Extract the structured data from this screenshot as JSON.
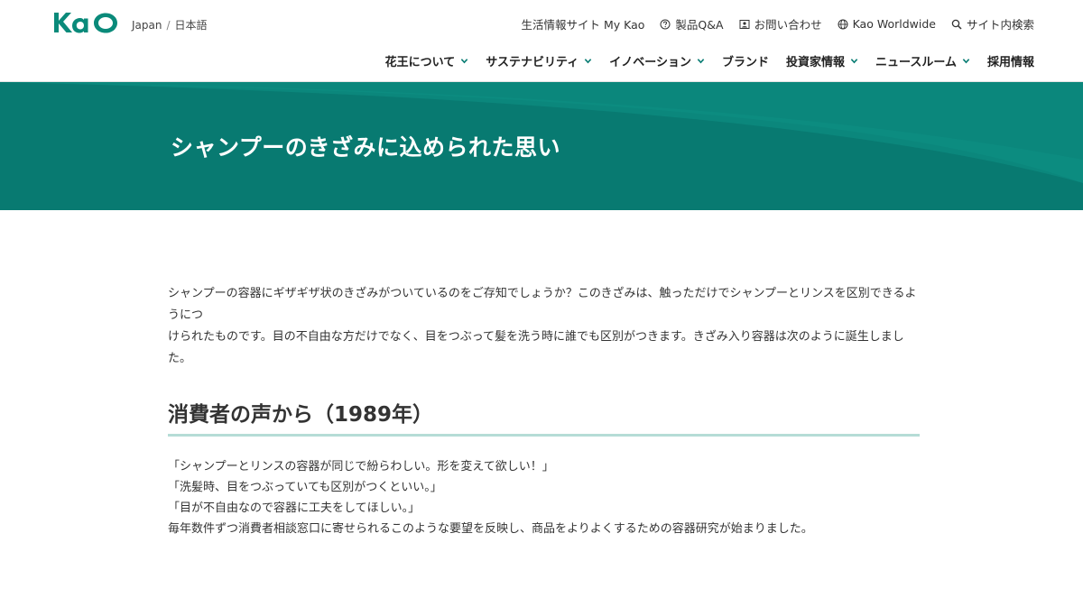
{
  "header": {
    "logo_text": "Kao",
    "region": "Japan",
    "separator": "/",
    "language": "日本語",
    "utility_nav": [
      {
        "label": "生活情報サイト My Kao",
        "icon": "none"
      },
      {
        "label": "製品Q&A",
        "icon": "question-circle-icon"
      },
      {
        "label": "お問い合わせ",
        "icon": "contact-icon"
      },
      {
        "label": "Kao Worldwide",
        "icon": "globe-icon"
      },
      {
        "label": "サイト内検索",
        "icon": "search-icon"
      }
    ],
    "main_nav": [
      {
        "label": "花王について",
        "has_dropdown": true
      },
      {
        "label": "サステナビリティ",
        "has_dropdown": true
      },
      {
        "label": "イノベーション",
        "has_dropdown": true
      },
      {
        "label": "ブランド",
        "has_dropdown": false
      },
      {
        "label": "投資家情報",
        "has_dropdown": true
      },
      {
        "label": "ニュースルーム",
        "has_dropdown": true
      },
      {
        "label": "採用情報",
        "has_dropdown": false
      }
    ]
  },
  "hero": {
    "title": "シャンプーのきざみに込められた思い"
  },
  "content": {
    "intro_line1": "シャンプーの容器にギザギザ状のきざみがついているのをご存知でしょうか？このきざみは、触っただけでシャンプーとリンスを区別できるようにつ",
    "intro_line2": "けられたものです。目の不自由な方だけでなく、目をつぶって髪を洗う時に誰でも区別がつきます。きざみ入り容器は次のように誕生しました。",
    "section_title": "消費者の声から（1989年）",
    "quotes": [
      "「シャンプーとリンスの容器が同じで紛らわしい。形を変えて欲しい！」",
      "「洗髪時、目をつぶっていても区別がつくといい。」",
      "「目が不自由なので容器に工夫をしてほしい。」",
      "毎年数件ずつ消費者相談窓口に寄せられるこのような要望を反映し、商品をよりよくするための容器研究が始まりました。"
    ]
  },
  "colors": {
    "brand_green": "#0a8a7a",
    "hero_bg": "#0a7d74",
    "section_underline": "#b5dcd6",
    "nav_chevron": "#0a7d74"
  }
}
